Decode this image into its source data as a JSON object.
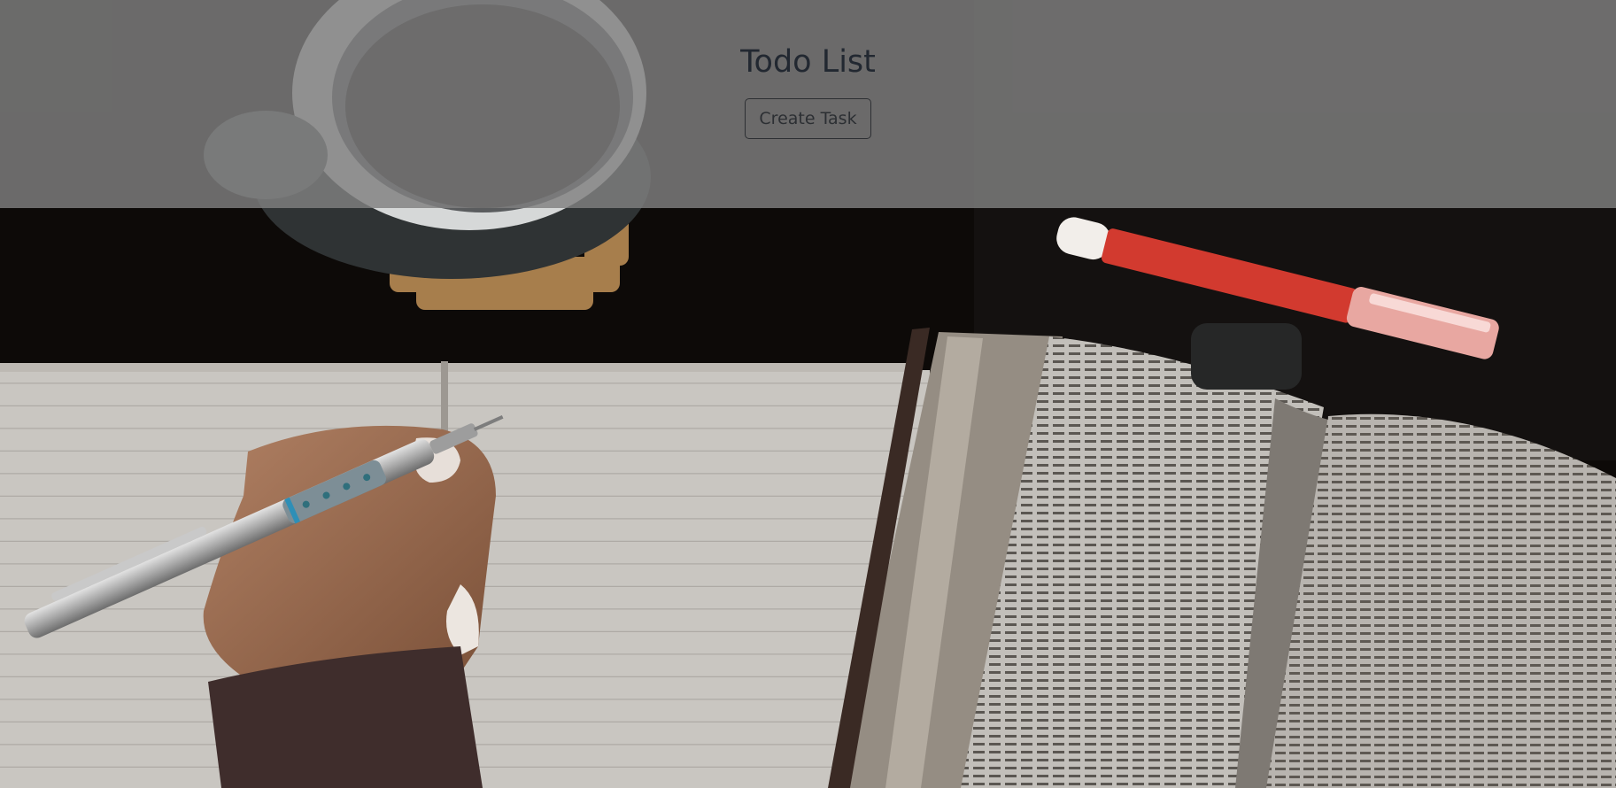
{
  "header": {
    "title": "Todo List",
    "create_task_label": "Create Task"
  },
  "colors": {
    "header_overlay": "#808080",
    "title_text": "#222831",
    "button_border": "#2d2f33"
  },
  "background": {
    "icon": "desk-notebook-bible-photo"
  }
}
